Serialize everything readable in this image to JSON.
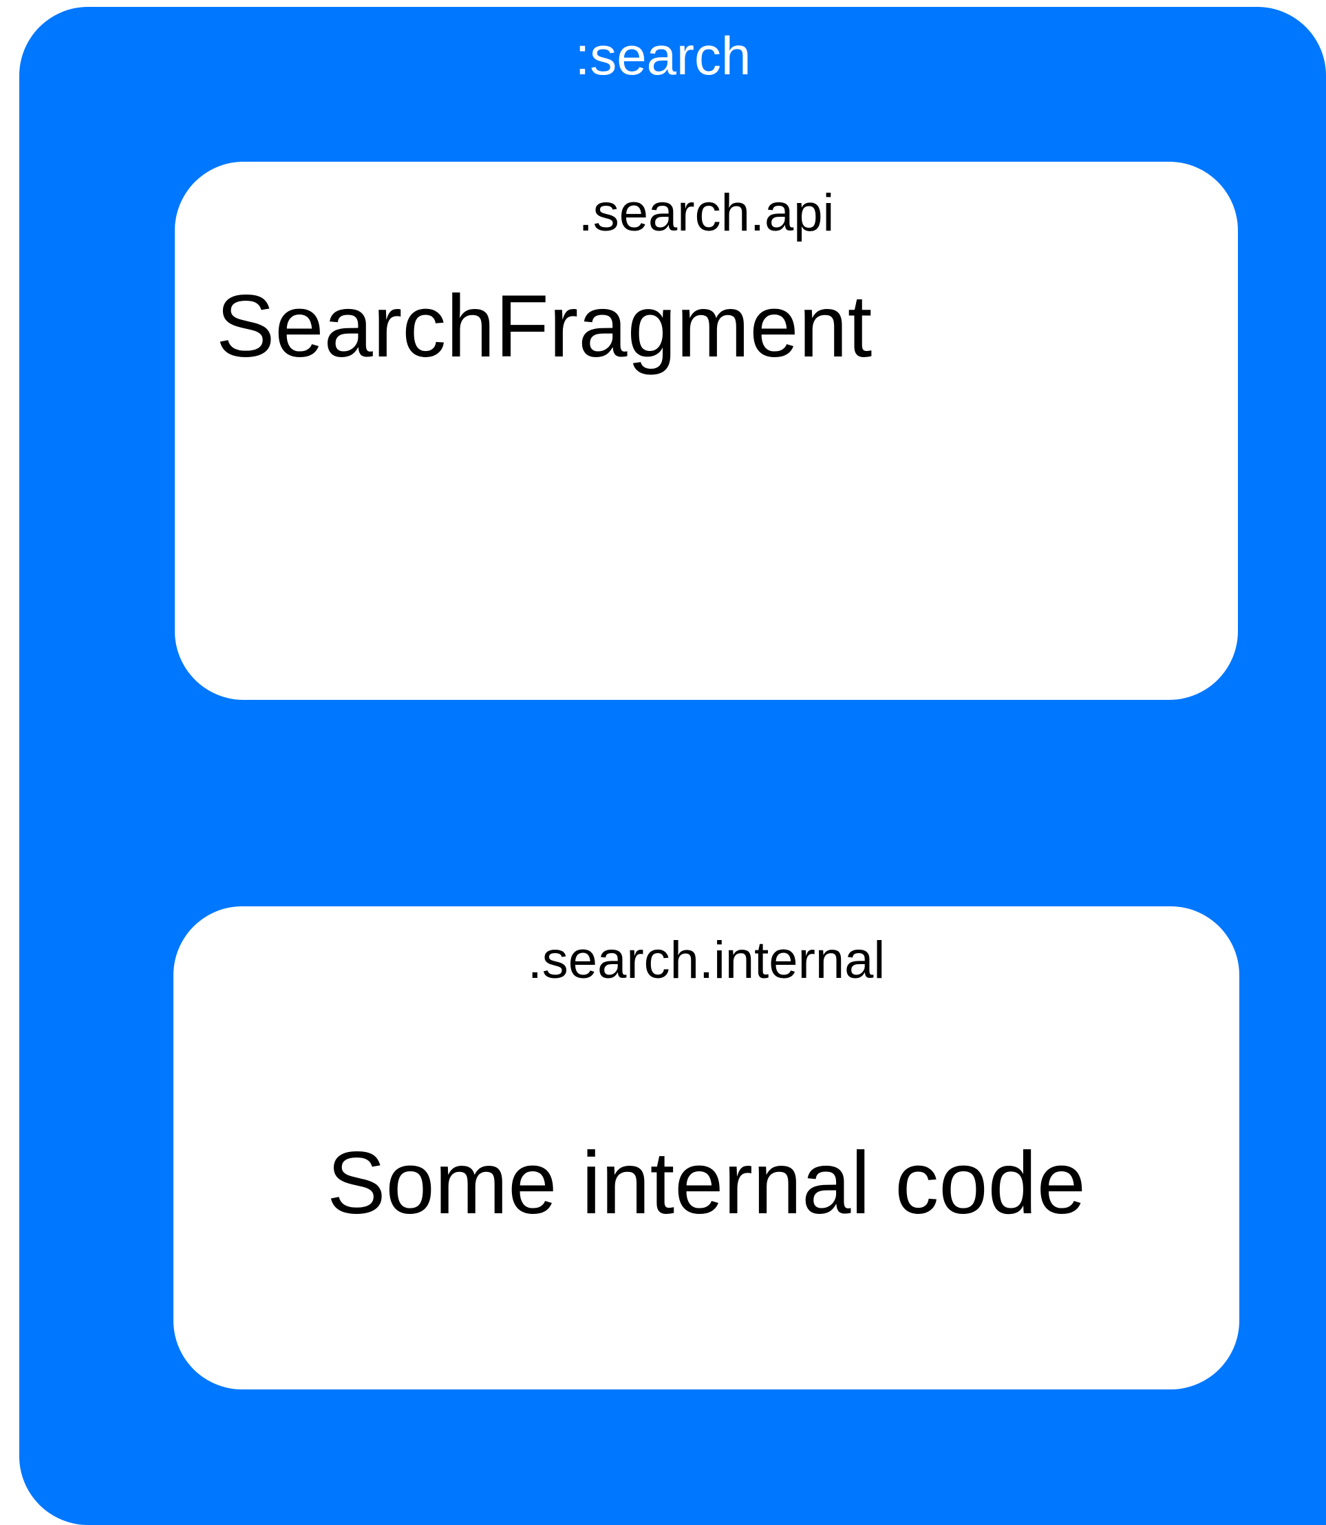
{
  "colors": {
    "module_fill": "#0077FF",
    "package_fill": "#FFFFFF",
    "module_text": "#FFFFFF",
    "package_text": "#000000"
  },
  "module": {
    "title": ":search"
  },
  "packages": [
    {
      "title": ".search.api",
      "content": "SearchFragment"
    },
    {
      "title": ".search.internal",
      "content": "Some internal code"
    }
  ]
}
